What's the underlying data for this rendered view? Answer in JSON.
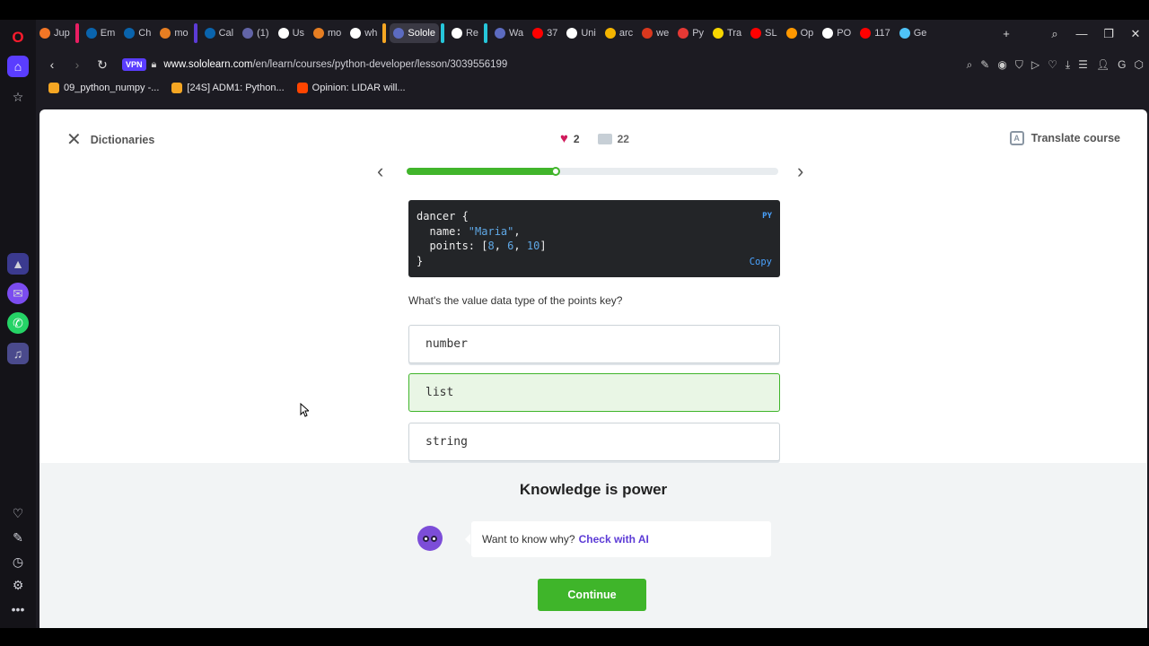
{
  "browser": {
    "tabs": [
      {
        "label": "Jup",
        "color": "#f37626"
      },
      {
        "label": "Em",
        "color": "#0a64ad"
      },
      {
        "label": "Ch",
        "color": "#0a64ad"
      },
      {
        "label": "mo",
        "color": "#e67e22"
      },
      {
        "label": "Cal",
        "color": "#0a64ad"
      },
      {
        "label": "(1)",
        "color": "#6264a7"
      },
      {
        "label": "Us",
        "color": "#ffffff"
      },
      {
        "label": "mo",
        "color": "#e67e22"
      },
      {
        "label": "wh",
        "color": "#ffffff"
      },
      {
        "label": "Solole",
        "color": "#5c6bc0",
        "active": true
      },
      {
        "label": "Re",
        "color": "#ffffff"
      },
      {
        "label": "Wa",
        "color": "#5c6bc0"
      },
      {
        "label": "37",
        "color": "#ff0000"
      },
      {
        "label": "Uni",
        "color": "#ffffff"
      },
      {
        "label": "arc",
        "color": "#f4b400"
      },
      {
        "label": "we",
        "color": "#d9381e"
      },
      {
        "label": "Py",
        "color": "#e53935"
      },
      {
        "label": "Tra",
        "color": "#f7d600"
      },
      {
        "label": "SL",
        "color": "#ff0000"
      },
      {
        "label": "Op",
        "color": "#ff9800"
      },
      {
        "label": "PO",
        "color": "#ffffff"
      },
      {
        "label": "117",
        "color": "#ff0000"
      },
      {
        "label": "Ge",
        "color": "#4fc3f7"
      }
    ],
    "vpn_label": "VPN",
    "url_host": "www.sololearn.com",
    "url_path": "/en/learn/courses/python-developer/lesson/3039556199",
    "bookmarks": [
      {
        "label": "09_python_numpy -...",
        "color": "#f5a623"
      },
      {
        "label": "[24S] ADM1: Python...",
        "color": "#f5a623"
      },
      {
        "label": "Opinion: LIDAR will...",
        "color": "#ff4500"
      }
    ]
  },
  "lesson": {
    "close_label": "Dictionaries",
    "hearts": "2",
    "comments": "22",
    "translate_label": "Translate course",
    "progress": 0.4
  },
  "code": {
    "lang": "PY",
    "copy_label": "Copy",
    "line1": "dancer {",
    "line2_key": "  name: ",
    "line2_val": "\"Maria\"",
    "line2_end": ",",
    "line3_key": "  points: [",
    "line3_v1": "8",
    "line3_v2": "6",
    "line3_v3": "10",
    "line3_end": "]",
    "line4": "}"
  },
  "question": {
    "text": "What's the value data type of the points key?",
    "options": [
      {
        "label": "number",
        "correct": false
      },
      {
        "label": "list",
        "correct": true
      },
      {
        "label": "string",
        "correct": false
      }
    ]
  },
  "feedback": {
    "title": "Knowledge is power",
    "prompt": "Want to know why?",
    "link": "Check with AI",
    "continue_label": "Continue"
  }
}
